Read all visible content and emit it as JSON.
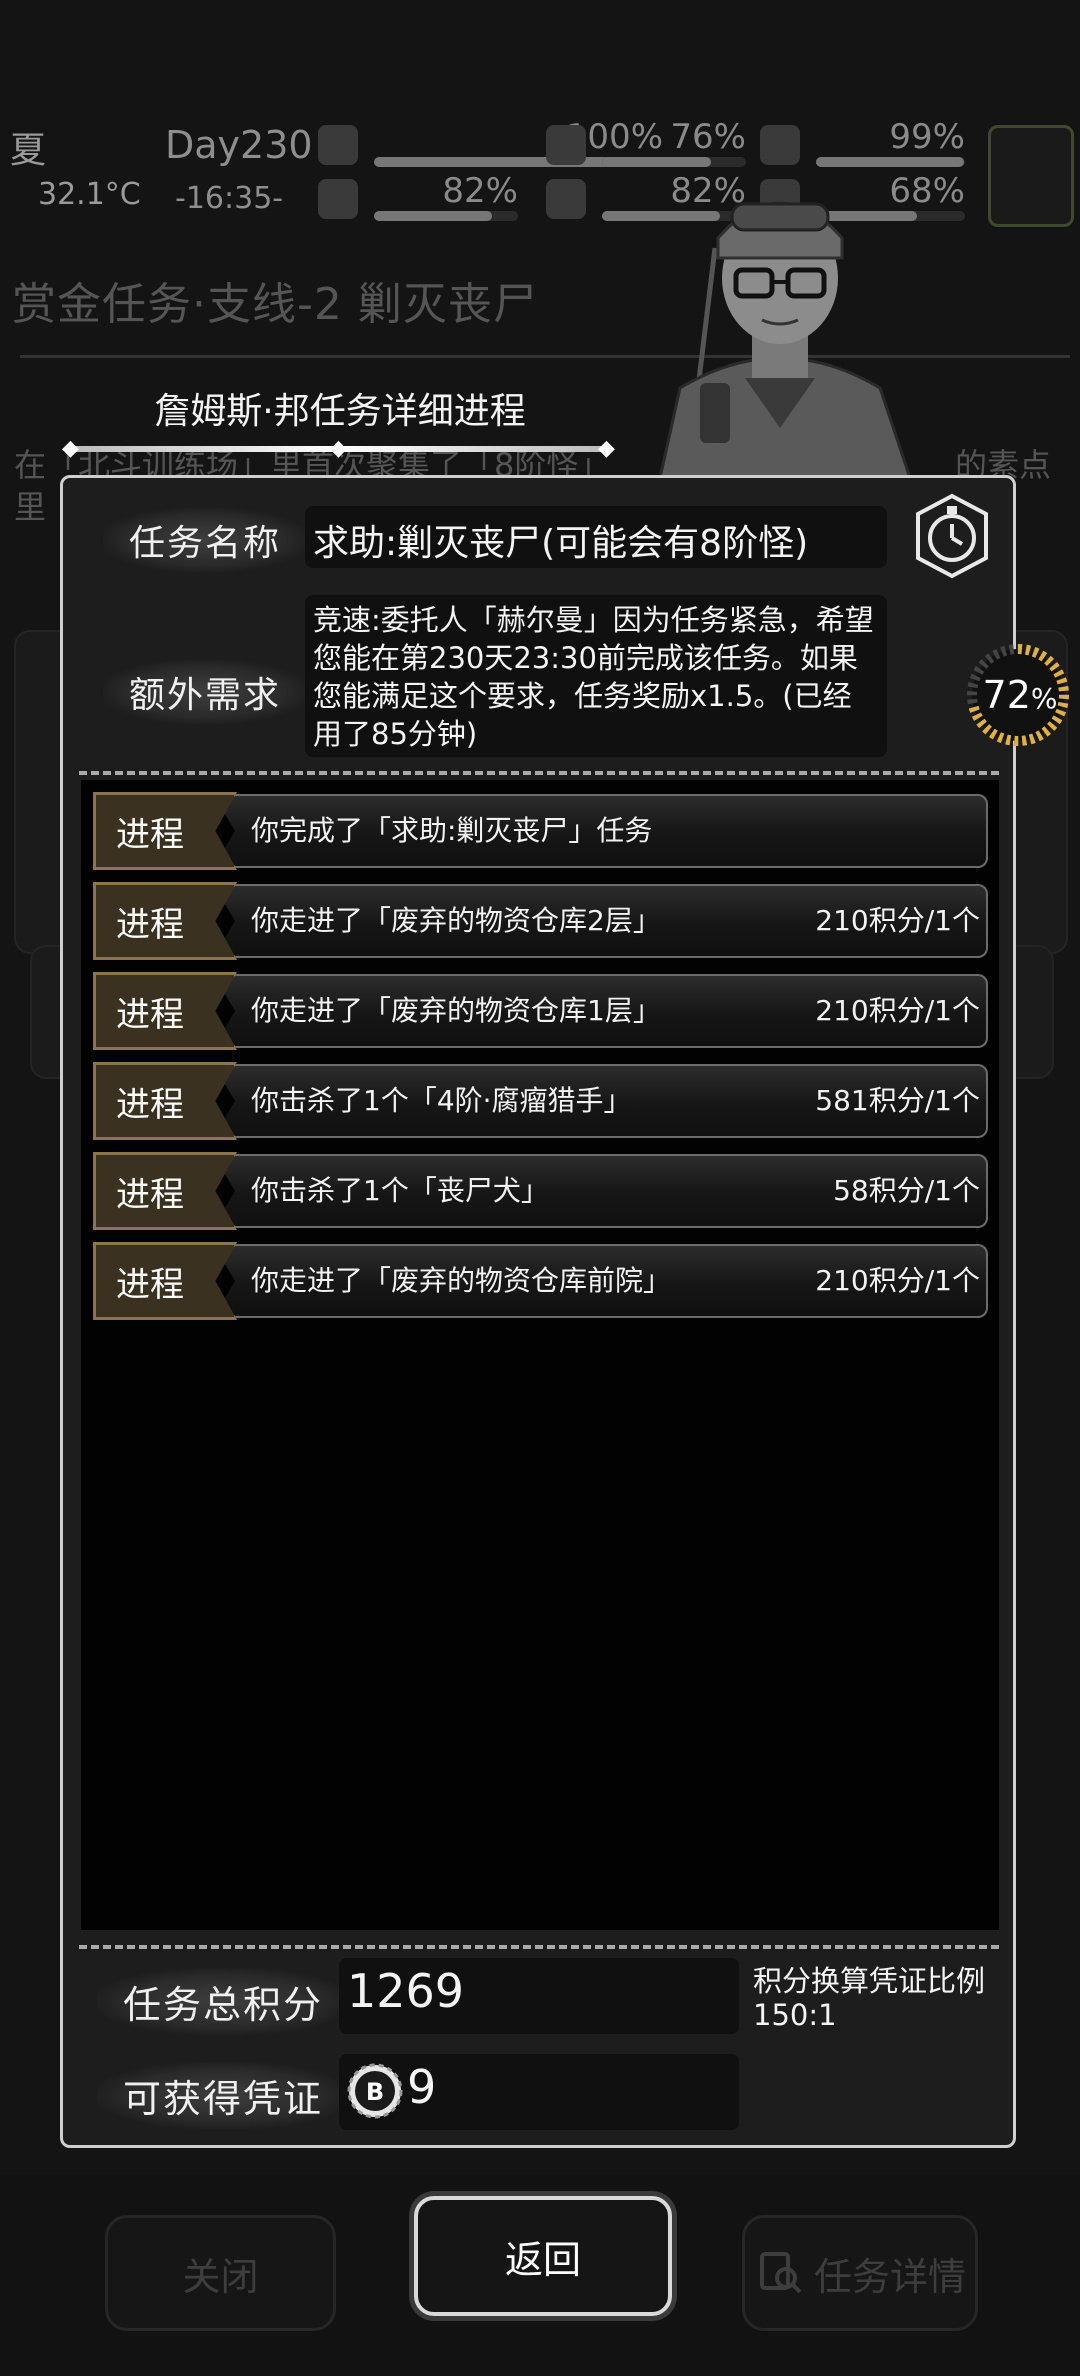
{
  "hud": {
    "season": "夏",
    "temperature": "32.1°C",
    "day": "Day230",
    "clock": "-16:35-",
    "stats": [
      {
        "icon": "medkit-icon",
        "value": "100%",
        "level": 1.0
      },
      {
        "icon": "stomach-icon",
        "value": "76%",
        "level": 0.76
      },
      {
        "icon": "battery-icon",
        "value": "99%",
        "level": 0.99
      },
      {
        "icon": "boot-icon",
        "value": "82%",
        "level": 0.82
      },
      {
        "icon": "water-drop-icon",
        "value": "82%",
        "level": 0.82
      },
      {
        "icon": "brain-icon",
        "value": "68%",
        "level": 0.68
      }
    ]
  },
  "background": {
    "title": "赏金任务·支线-2 剿灭丧尸",
    "text1": "在「北斗训练场」里首次聚集了「8阶怪」",
    "text2": "里",
    "text3": "的素点"
  },
  "dialog": {
    "banner_title": "詹姆斯·邦任务详细进程",
    "task_name_label": "任务名称",
    "task_name": "求助:剿灭丧尸(可能会有8阶怪)",
    "extra_label": "额外需求",
    "extra_text": "竞速:委托人「赫尔曼」因为任务紧急，希望您能在第230天23:30前完成该任务。如果您能满足这个要求，任务奖励x1.5。(已经用了85分钟)",
    "timer_value": "72",
    "timer_unit": "%",
    "progress_label": "进程",
    "progress": [
      {
        "text": "你完成了「求助:剿灭丧尸」任务",
        "score": ""
      },
      {
        "text": "你走进了「废弃的物资仓库2层」",
        "score": "210积分/1个"
      },
      {
        "text": "你走进了「废弃的物资仓库1层」",
        "score": "210积分/1个"
      },
      {
        "text": "你击杀了1个「4阶·腐瘤猎手」",
        "score": "581积分/1个"
      },
      {
        "text": "你击杀了1个「丧尸犬」",
        "score": "58积分/1个"
      },
      {
        "text": "你走进了「废弃的物资仓库前院」",
        "score": "210积分/1个"
      }
    ],
    "total_label": "任务总积分",
    "total_value": "1269",
    "ratio_label": "积分换算凭证比例",
    "ratio_value": "150:1",
    "voucher_label": "可获得凭证",
    "voucher_value": "9"
  },
  "buttons": {
    "close": "关闭",
    "return": "返回",
    "details": "任务详情"
  },
  "colors": {
    "badge_bg": "#3a3120",
    "badge_border": "#8a7550",
    "timer_ring": "#e0b040"
  }
}
